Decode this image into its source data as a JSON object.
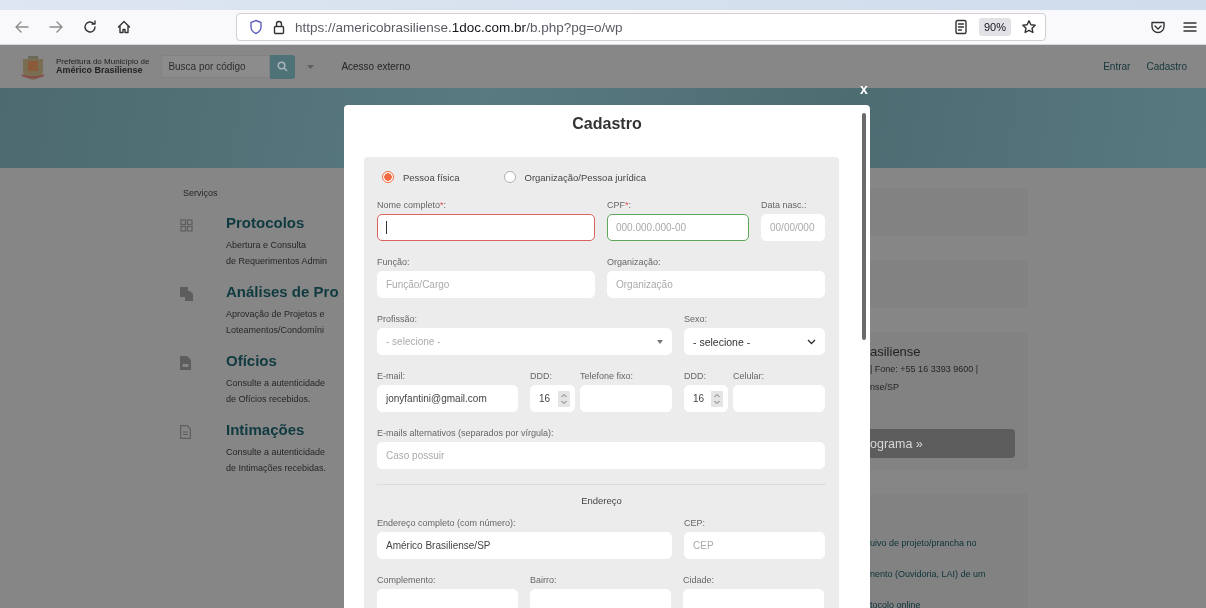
{
  "browser": {
    "url": "https://americobrasiliense.**1doc.com.br**/b.php?pg=o/wp",
    "zoom": "90%"
  },
  "site_header": {
    "logo_lines": [
      "Prefeitura do Município de",
      "Américo Brasiliense"
    ],
    "search": {
      "placeholder": "Busca por código"
    },
    "external_access": "Acesso externo",
    "links": [
      "Entrar",
      "Cadastro"
    ]
  },
  "services": {
    "title": "Serviços",
    "items": [
      {
        "kind": "grid",
        "title": "Protocolos",
        "lines": [
          "Abertura e Consulta",
          "de Requerimentos Admin"
        ]
      },
      {
        "kind": "copy",
        "title": "Análises de Pro",
        "lines": [
          "Aprovação de Projetos e",
          "Loteamentos/Condomíni"
        ]
      },
      {
        "kind": "doc",
        "title": "Ofícios",
        "lines": [
          "Consulte a autenticidade",
          "de Ofícios recebidos."
        ]
      },
      {
        "kind": "page",
        "title": "Intimações",
        "lines": [
          "Consulte a autenticidade",
          "de Intimações recebidas."
        ]
      }
    ]
  },
  "right_panel": {
    "address_title": "asiliense",
    "address_lines": [
      "| Fone: +55 16 3393 9600 |",
      "nse/SP"
    ],
    "button": "ograma »",
    "links": [
      "uivo de projeto/prancha no",
      "nento (Ouvidoria, LAI) de um",
      "tocolo online"
    ]
  },
  "modal": {
    "close": "x",
    "title": "Cadastro",
    "person_types": [
      {
        "label": "Pessoa física",
        "selected": true
      },
      {
        "label": "Organização/Pessoa jurídica",
        "selected": false
      }
    ],
    "sections": [
      {
        "fields": [
          {
            "kind": "text",
            "label": "Nome completo",
            "required": "*",
            "suffix": ":",
            "error": true,
            "focused": true
          },
          {
            "kind": "text",
            "label": "CPF",
            "required": "*",
            "suffix": ":",
            "placeholder": "000.000.000-00",
            "valid": true
          },
          {
            "kind": "text",
            "label": "Data nasc.:",
            "placeholder": "00/00/000"
          },
          {
            "kind": "text",
            "label": "Função:",
            "placeholder": "Função/Cargo"
          },
          {
            "kind": "text",
            "label": "Organização:",
            "placeholder": "Organização"
          },
          {
            "kind": "select",
            "label": "Profissão:",
            "placeholder": "- selecione -"
          },
          {
            "kind": "dropdown",
            "label": "Sexo:",
            "value": "- selecione -"
          },
          {
            "kind": "text",
            "label": "E-mail:",
            "value": "jonyfantini@gmail.com"
          },
          {
            "kind": "number",
            "label": "DDD:",
            "value": "16"
          },
          {
            "kind": "text",
            "label": "Telefone fixo:"
          },
          {
            "kind": "number",
            "label": "DDD:",
            "value": "16"
          },
          {
            "kind": "text",
            "label": "Celular:"
          },
          {
            "kind": "text",
            "label": "E-mails alternativos (separados por vírgula):",
            "placeholder": "Caso possuir"
          }
        ]
      },
      {
        "heading": "Endereço",
        "fields": [
          {
            "kind": "text",
            "label": "Endereço completo (com número):",
            "value": "Américo Brasiliense/SP"
          },
          {
            "kind": "text",
            "label": "CEP:",
            "placeholder": "CEP"
          },
          {
            "kind": "text",
            "label": "Complemento:"
          },
          {
            "kind": "text",
            "label": "Bairro:"
          },
          {
            "kind": "text",
            "label": "Cidade:"
          }
        ]
      }
    ]
  }
}
